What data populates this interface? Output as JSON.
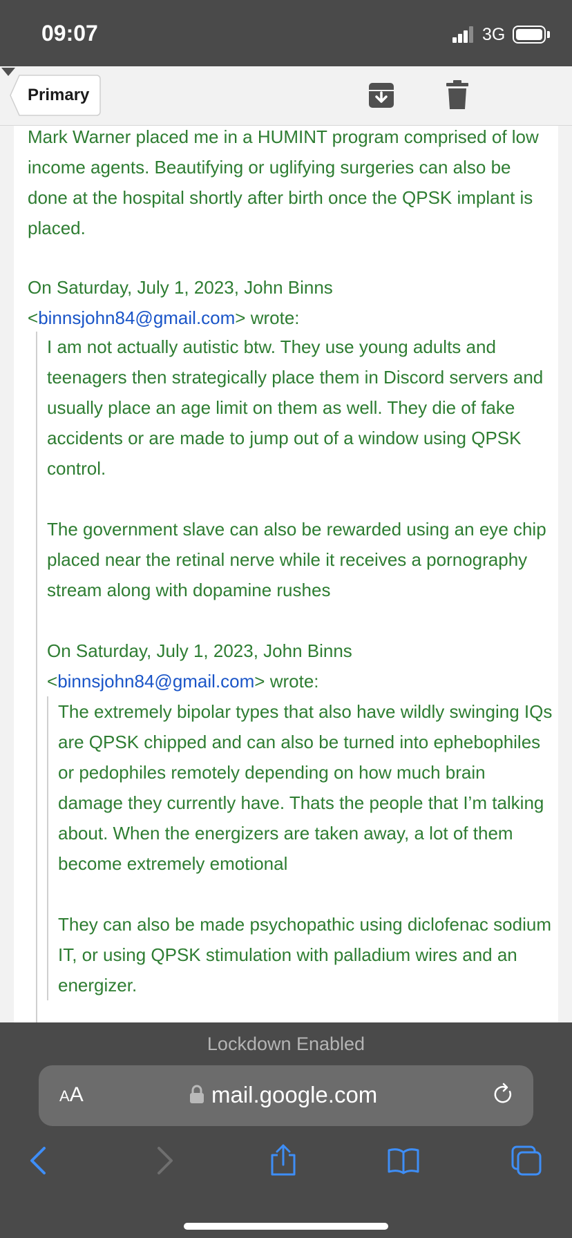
{
  "status_bar": {
    "time": "09:07",
    "network": "3G"
  },
  "mail_toolbar": {
    "back_label": "Primary"
  },
  "message": {
    "top_paragraph": "Mark Warner placed me in a HUMINT program comprised of low income agents. Beautifying or uglifying surgeries can also be done at the hospital shortly after birth once the QPSK implant is placed.",
    "quote1_header_prefix": "On Saturday, July 1, 2023, John Binns <",
    "quote1_email": "binnsjohn84@gmail.com",
    "quote1_header_suffix": "> wrote:",
    "quote1_p1": "I am not actually autistic btw. They use young adults and teenagers then strategically place them in Discord servers and usually place an age limit on them as well. They die of fake accidents or are made to jump out of a window using QPSK control.",
    "quote1_p2": "The government slave can also be rewarded using an eye chip placed near the retinal nerve while it receives a pornography stream along with dopamine rushes",
    "quote2_header_prefix": "On Saturday, July 1, 2023, John Binns <",
    "quote2_email": "binnsjohn84@gmail.com",
    "quote2_header_suffix": "> wrote:",
    "quote2_p1": "The extremely bipolar types that also have wildly swinging IQs are QPSK chipped and can also be turned into ephebophiles or pedophiles remotely depending on how much brain damage they currently have. Thats the people that I’m talking about. When the energizers are taken away, a lot of them become extremely emotional",
    "quote2_p2": "They can also be made psychopathic using diclofenac sodium IT, or using QPSK stimulation with palladium wires and an energizer."
  },
  "browser": {
    "lockdown_text": "Lockdown Enabled",
    "aa_big": "A",
    "aa_small": "A",
    "url": "mail.google.com"
  },
  "colors": {
    "status_bg": "#4a4a4a",
    "message_text": "#2e7d32",
    "link": "#1a55c8",
    "accent_blue": "#3e8ef7"
  }
}
